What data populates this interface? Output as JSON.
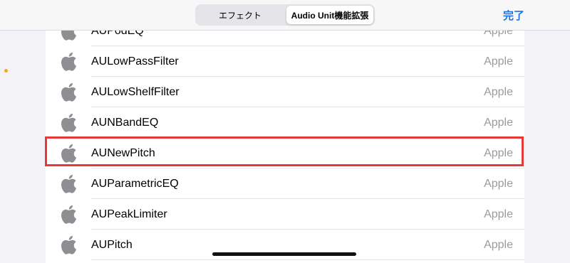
{
  "header": {
    "tabs": [
      {
        "label": "エフェクト",
        "selected": false
      },
      {
        "label": "Audio Unit機能拡張",
        "selected": true
      }
    ],
    "done_label": "完了",
    "accent_color": "#1a73e8"
  },
  "plugins": [
    {
      "name": "AUPodEQ",
      "vendor": "Apple",
      "icon": "apple-logo-icon"
    },
    {
      "name": "AULowPassFilter",
      "vendor": "Apple",
      "icon": "apple-logo-icon"
    },
    {
      "name": "AULowShelfFilter",
      "vendor": "Apple",
      "icon": "apple-logo-icon"
    },
    {
      "name": "AUNBandEQ",
      "vendor": "Apple",
      "icon": "apple-logo-icon"
    },
    {
      "name": "AUNewPitch",
      "vendor": "Apple",
      "icon": "apple-logo-icon",
      "highlighted": true
    },
    {
      "name": "AUParametricEQ",
      "vendor": "Apple",
      "icon": "apple-logo-icon"
    },
    {
      "name": "AUPeakLimiter",
      "vendor": "Apple",
      "icon": "apple-logo-icon"
    },
    {
      "name": "AUPitch",
      "vendor": "Apple",
      "icon": "apple-logo-icon"
    }
  ],
  "highlight_color": "#e53935"
}
